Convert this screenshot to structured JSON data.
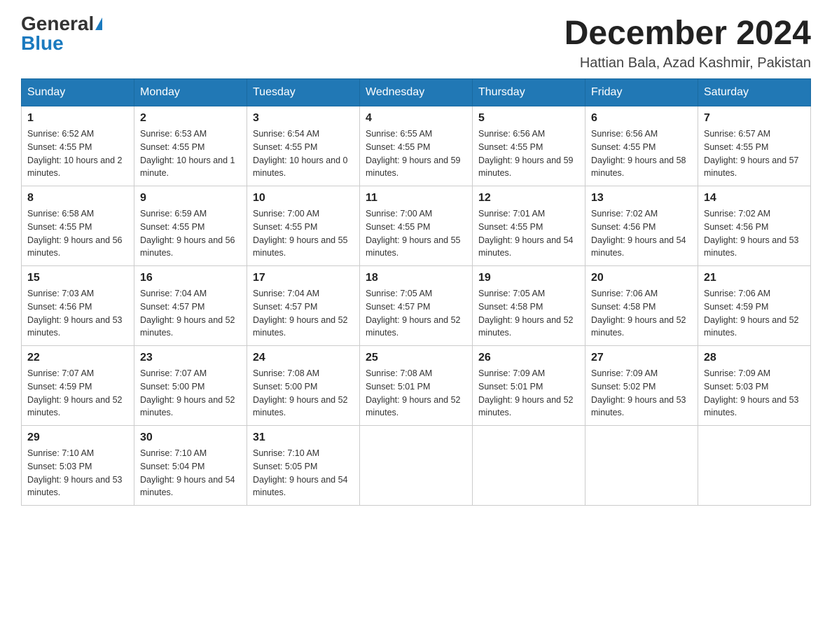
{
  "header": {
    "logo_general": "General",
    "logo_blue": "Blue",
    "month_title": "December 2024",
    "location": "Hattian Bala, Azad Kashmir, Pakistan"
  },
  "weekdays": [
    "Sunday",
    "Monday",
    "Tuesday",
    "Wednesday",
    "Thursday",
    "Friday",
    "Saturday"
  ],
  "weeks": [
    [
      {
        "day": "1",
        "sunrise": "6:52 AM",
        "sunset": "4:55 PM",
        "daylight": "10 hours and 2 minutes."
      },
      {
        "day": "2",
        "sunrise": "6:53 AM",
        "sunset": "4:55 PM",
        "daylight": "10 hours and 1 minute."
      },
      {
        "day": "3",
        "sunrise": "6:54 AM",
        "sunset": "4:55 PM",
        "daylight": "10 hours and 0 minutes."
      },
      {
        "day": "4",
        "sunrise": "6:55 AM",
        "sunset": "4:55 PM",
        "daylight": "9 hours and 59 minutes."
      },
      {
        "day": "5",
        "sunrise": "6:56 AM",
        "sunset": "4:55 PM",
        "daylight": "9 hours and 59 minutes."
      },
      {
        "day": "6",
        "sunrise": "6:56 AM",
        "sunset": "4:55 PM",
        "daylight": "9 hours and 58 minutes."
      },
      {
        "day": "7",
        "sunrise": "6:57 AM",
        "sunset": "4:55 PM",
        "daylight": "9 hours and 57 minutes."
      }
    ],
    [
      {
        "day": "8",
        "sunrise": "6:58 AM",
        "sunset": "4:55 PM",
        "daylight": "9 hours and 56 minutes."
      },
      {
        "day": "9",
        "sunrise": "6:59 AM",
        "sunset": "4:55 PM",
        "daylight": "9 hours and 56 minutes."
      },
      {
        "day": "10",
        "sunrise": "7:00 AM",
        "sunset": "4:55 PM",
        "daylight": "9 hours and 55 minutes."
      },
      {
        "day": "11",
        "sunrise": "7:00 AM",
        "sunset": "4:55 PM",
        "daylight": "9 hours and 55 minutes."
      },
      {
        "day": "12",
        "sunrise": "7:01 AM",
        "sunset": "4:55 PM",
        "daylight": "9 hours and 54 minutes."
      },
      {
        "day": "13",
        "sunrise": "7:02 AM",
        "sunset": "4:56 PM",
        "daylight": "9 hours and 54 minutes."
      },
      {
        "day": "14",
        "sunrise": "7:02 AM",
        "sunset": "4:56 PM",
        "daylight": "9 hours and 53 minutes."
      }
    ],
    [
      {
        "day": "15",
        "sunrise": "7:03 AM",
        "sunset": "4:56 PM",
        "daylight": "9 hours and 53 minutes."
      },
      {
        "day": "16",
        "sunrise": "7:04 AM",
        "sunset": "4:57 PM",
        "daylight": "9 hours and 52 minutes."
      },
      {
        "day": "17",
        "sunrise": "7:04 AM",
        "sunset": "4:57 PM",
        "daylight": "9 hours and 52 minutes."
      },
      {
        "day": "18",
        "sunrise": "7:05 AM",
        "sunset": "4:57 PM",
        "daylight": "9 hours and 52 minutes."
      },
      {
        "day": "19",
        "sunrise": "7:05 AM",
        "sunset": "4:58 PM",
        "daylight": "9 hours and 52 minutes."
      },
      {
        "day": "20",
        "sunrise": "7:06 AM",
        "sunset": "4:58 PM",
        "daylight": "9 hours and 52 minutes."
      },
      {
        "day": "21",
        "sunrise": "7:06 AM",
        "sunset": "4:59 PM",
        "daylight": "9 hours and 52 minutes."
      }
    ],
    [
      {
        "day": "22",
        "sunrise": "7:07 AM",
        "sunset": "4:59 PM",
        "daylight": "9 hours and 52 minutes."
      },
      {
        "day": "23",
        "sunrise": "7:07 AM",
        "sunset": "5:00 PM",
        "daylight": "9 hours and 52 minutes."
      },
      {
        "day": "24",
        "sunrise": "7:08 AM",
        "sunset": "5:00 PM",
        "daylight": "9 hours and 52 minutes."
      },
      {
        "day": "25",
        "sunrise": "7:08 AM",
        "sunset": "5:01 PM",
        "daylight": "9 hours and 52 minutes."
      },
      {
        "day": "26",
        "sunrise": "7:09 AM",
        "sunset": "5:01 PM",
        "daylight": "9 hours and 52 minutes."
      },
      {
        "day": "27",
        "sunrise": "7:09 AM",
        "sunset": "5:02 PM",
        "daylight": "9 hours and 53 minutes."
      },
      {
        "day": "28",
        "sunrise": "7:09 AM",
        "sunset": "5:03 PM",
        "daylight": "9 hours and 53 minutes."
      }
    ],
    [
      {
        "day": "29",
        "sunrise": "7:10 AM",
        "sunset": "5:03 PM",
        "daylight": "9 hours and 53 minutes."
      },
      {
        "day": "30",
        "sunrise": "7:10 AM",
        "sunset": "5:04 PM",
        "daylight": "9 hours and 54 minutes."
      },
      {
        "day": "31",
        "sunrise": "7:10 AM",
        "sunset": "5:05 PM",
        "daylight": "9 hours and 54 minutes."
      },
      null,
      null,
      null,
      null
    ]
  ]
}
